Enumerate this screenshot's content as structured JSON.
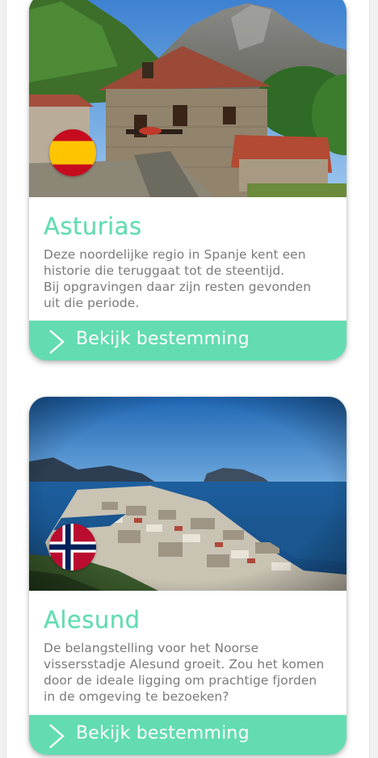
{
  "colors": {
    "accent": "#63dcb1",
    "text": "#7a7a7a",
    "button_text": "#ffffff"
  },
  "destinations": [
    {
      "title": "Asturias",
      "flag": "spain-flag",
      "image": "asturias-stone-house-mountains",
      "description_lines": [
        "Deze noordelijke regio in Spanje kent een",
        "historie die teruggaat tot de steentijd.",
        "Bij opgravingen daar zijn resten gevonden",
        "uit die periode."
      ],
      "cta_label": "Bekijk bestemming",
      "cta_icon": "chevron-right-icon"
    },
    {
      "title": "Alesund",
      "flag": "norway-flag",
      "image": "alesund-aerial-harbour",
      "description_lines": [
        "De belangstelling voor het Noorse",
        "vissersstadje Alesund groeit. Zou het komen",
        "door de ideale ligging om prachtige fjorden",
        "in de omgeving te bezoeken?"
      ],
      "cta_label": "Bekijk bestemming",
      "cta_icon": "chevron-right-icon"
    }
  ]
}
